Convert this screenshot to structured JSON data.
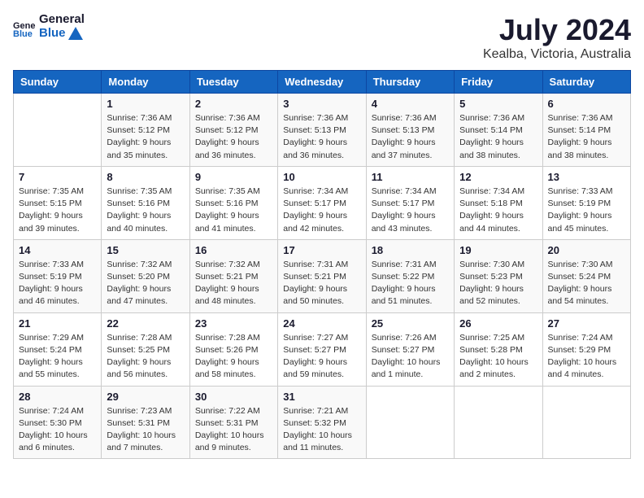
{
  "header": {
    "logo_general": "General",
    "logo_blue": "Blue",
    "month": "July 2024",
    "location": "Kealba, Victoria, Australia"
  },
  "calendar": {
    "days_of_week": [
      "Sunday",
      "Monday",
      "Tuesday",
      "Wednesday",
      "Thursday",
      "Friday",
      "Saturday"
    ],
    "weeks": [
      [
        {
          "day": "",
          "info": ""
        },
        {
          "day": "1",
          "info": "Sunrise: 7:36 AM\nSunset: 5:12 PM\nDaylight: 9 hours\nand 35 minutes."
        },
        {
          "day": "2",
          "info": "Sunrise: 7:36 AM\nSunset: 5:12 PM\nDaylight: 9 hours\nand 36 minutes."
        },
        {
          "day": "3",
          "info": "Sunrise: 7:36 AM\nSunset: 5:13 PM\nDaylight: 9 hours\nand 36 minutes."
        },
        {
          "day": "4",
          "info": "Sunrise: 7:36 AM\nSunset: 5:13 PM\nDaylight: 9 hours\nand 37 minutes."
        },
        {
          "day": "5",
          "info": "Sunrise: 7:36 AM\nSunset: 5:14 PM\nDaylight: 9 hours\nand 38 minutes."
        },
        {
          "day": "6",
          "info": "Sunrise: 7:36 AM\nSunset: 5:14 PM\nDaylight: 9 hours\nand 38 minutes."
        }
      ],
      [
        {
          "day": "7",
          "info": "Sunrise: 7:35 AM\nSunset: 5:15 PM\nDaylight: 9 hours\nand 39 minutes."
        },
        {
          "day": "8",
          "info": "Sunrise: 7:35 AM\nSunset: 5:16 PM\nDaylight: 9 hours\nand 40 minutes."
        },
        {
          "day": "9",
          "info": "Sunrise: 7:35 AM\nSunset: 5:16 PM\nDaylight: 9 hours\nand 41 minutes."
        },
        {
          "day": "10",
          "info": "Sunrise: 7:34 AM\nSunset: 5:17 PM\nDaylight: 9 hours\nand 42 minutes."
        },
        {
          "day": "11",
          "info": "Sunrise: 7:34 AM\nSunset: 5:17 PM\nDaylight: 9 hours\nand 43 minutes."
        },
        {
          "day": "12",
          "info": "Sunrise: 7:34 AM\nSunset: 5:18 PM\nDaylight: 9 hours\nand 44 minutes."
        },
        {
          "day": "13",
          "info": "Sunrise: 7:33 AM\nSunset: 5:19 PM\nDaylight: 9 hours\nand 45 minutes."
        }
      ],
      [
        {
          "day": "14",
          "info": "Sunrise: 7:33 AM\nSunset: 5:19 PM\nDaylight: 9 hours\nand 46 minutes."
        },
        {
          "day": "15",
          "info": "Sunrise: 7:32 AM\nSunset: 5:20 PM\nDaylight: 9 hours\nand 47 minutes."
        },
        {
          "day": "16",
          "info": "Sunrise: 7:32 AM\nSunset: 5:21 PM\nDaylight: 9 hours\nand 48 minutes."
        },
        {
          "day": "17",
          "info": "Sunrise: 7:31 AM\nSunset: 5:21 PM\nDaylight: 9 hours\nand 50 minutes."
        },
        {
          "day": "18",
          "info": "Sunrise: 7:31 AM\nSunset: 5:22 PM\nDaylight: 9 hours\nand 51 minutes."
        },
        {
          "day": "19",
          "info": "Sunrise: 7:30 AM\nSunset: 5:23 PM\nDaylight: 9 hours\nand 52 minutes."
        },
        {
          "day": "20",
          "info": "Sunrise: 7:30 AM\nSunset: 5:24 PM\nDaylight: 9 hours\nand 54 minutes."
        }
      ],
      [
        {
          "day": "21",
          "info": "Sunrise: 7:29 AM\nSunset: 5:24 PM\nDaylight: 9 hours\nand 55 minutes."
        },
        {
          "day": "22",
          "info": "Sunrise: 7:28 AM\nSunset: 5:25 PM\nDaylight: 9 hours\nand 56 minutes."
        },
        {
          "day": "23",
          "info": "Sunrise: 7:28 AM\nSunset: 5:26 PM\nDaylight: 9 hours\nand 58 minutes."
        },
        {
          "day": "24",
          "info": "Sunrise: 7:27 AM\nSunset: 5:27 PM\nDaylight: 9 hours\nand 59 minutes."
        },
        {
          "day": "25",
          "info": "Sunrise: 7:26 AM\nSunset: 5:27 PM\nDaylight: 10 hours\nand 1 minute."
        },
        {
          "day": "26",
          "info": "Sunrise: 7:25 AM\nSunset: 5:28 PM\nDaylight: 10 hours\nand 2 minutes."
        },
        {
          "day": "27",
          "info": "Sunrise: 7:24 AM\nSunset: 5:29 PM\nDaylight: 10 hours\nand 4 minutes."
        }
      ],
      [
        {
          "day": "28",
          "info": "Sunrise: 7:24 AM\nSunset: 5:30 PM\nDaylight: 10 hours\nand 6 minutes."
        },
        {
          "day": "29",
          "info": "Sunrise: 7:23 AM\nSunset: 5:31 PM\nDaylight: 10 hours\nand 7 minutes."
        },
        {
          "day": "30",
          "info": "Sunrise: 7:22 AM\nSunset: 5:31 PM\nDaylight: 10 hours\nand 9 minutes."
        },
        {
          "day": "31",
          "info": "Sunrise: 7:21 AM\nSunset: 5:32 PM\nDaylight: 10 hours\nand 11 minutes."
        },
        {
          "day": "",
          "info": ""
        },
        {
          "day": "",
          "info": ""
        },
        {
          "day": "",
          "info": ""
        }
      ]
    ]
  }
}
